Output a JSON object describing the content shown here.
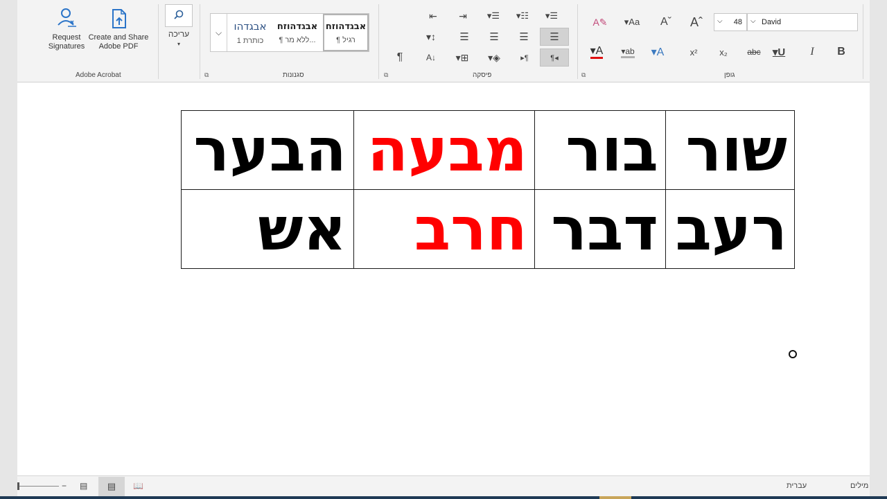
{
  "ribbon": {
    "acrobat": {
      "request_label": "Request Signatures",
      "create_label": "Create and Share Adobe PDF",
      "group_label": "Adobe Acrobat"
    },
    "editing": {
      "label": "עריכה"
    },
    "styles": {
      "group_label": "סגנונות",
      "items": [
        {
          "sample": "אבגדהו",
          "name": "כותרת 1"
        },
        {
          "sample": "אבגדהוזח",
          "name": "¶ ללא מר..."
        },
        {
          "sample": "אבגדהוזח",
          "name": "¶ רגיל"
        }
      ]
    },
    "paragraph": {
      "group_label": "פיסקה"
    },
    "font": {
      "group_label": "גופן",
      "size": "48",
      "name": "David"
    }
  },
  "table": {
    "rows": [
      [
        {
          "text": "שור",
          "color": "#000000"
        },
        {
          "text": "בור",
          "color": "#000000"
        },
        {
          "text": "מבעה",
          "color": "#ff0000"
        },
        {
          "text": "הבער",
          "color": "#000000"
        }
      ],
      [
        {
          "text": "רעב",
          "color": "#000000"
        },
        {
          "text": "דבר",
          "color": "#000000"
        },
        {
          "text": "חרב",
          "color": "#ff0000"
        },
        {
          "text": "אש",
          "color": "#000000"
        }
      ]
    ]
  },
  "status": {
    "words_label": "מילים",
    "language": "עברית"
  }
}
